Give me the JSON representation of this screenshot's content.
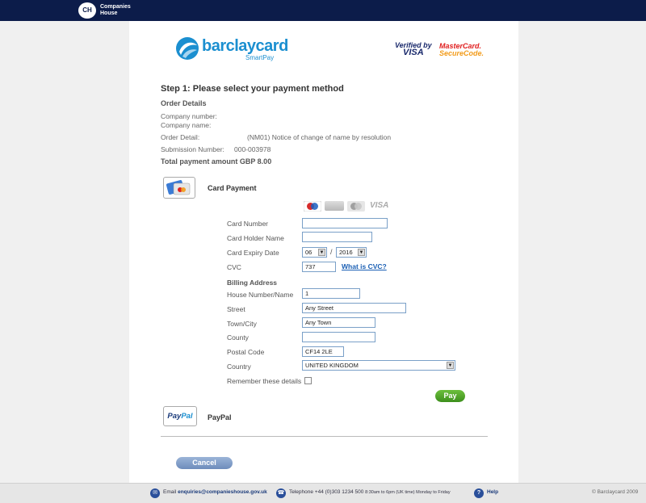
{
  "header": {
    "logo_initials": "CH",
    "logo_text": "Companies House"
  },
  "brand": {
    "name": "barclaycard",
    "product": "SmartPay",
    "verified_by": "Verified by",
    "visa": "VISA",
    "mastercard": "MasterCard.",
    "securecode": "SecureCode."
  },
  "step_title": "Step 1: Please select your payment method",
  "order": {
    "heading": "Order Details",
    "company_number_label": "Company number:",
    "company_name_label": "Company name:",
    "order_detail_label": "Order Detail:",
    "order_detail_value": "(NM01) Notice of change of name by resolution",
    "submission_label": "Submission Number:",
    "submission_value": "000-003978",
    "total": "Total payment amount GBP 8.00"
  },
  "card_payment": {
    "label": "Card Payment",
    "accepted_logo_visa": "VISA",
    "fields": {
      "card_number_label": "Card Number",
      "card_number_value": "",
      "card_holder_label": "Card Holder Name",
      "card_holder_value": "",
      "expiry_label": "Card Expiry Date",
      "expiry_month": "06",
      "expiry_sep": "/",
      "expiry_year": "2016",
      "cvc_label": "CVC",
      "cvc_value": "737",
      "what_is_cvc": "What is CVC?"
    },
    "billing": {
      "heading": "Billing Address",
      "house_label": "House Number/Name",
      "house_value": "1",
      "street_label": "Street",
      "street_value": "Any Street",
      "town_label": "Town/City",
      "town_value": "Any Town",
      "county_label": "County",
      "county_value": "",
      "postal_label": "Postal Code",
      "postal_value": "CF14 2LE",
      "country_label": "Country",
      "country_value": "UNITED KINGDOM",
      "remember_label": "Remember these details"
    },
    "pay_button": "Pay"
  },
  "paypal": {
    "logo_part1": "Pay",
    "logo_part2": "Pal",
    "label": "PayPal"
  },
  "cancel_button": "Cancel",
  "footer": {
    "email_prefix": "Email",
    "email": "enquiries@companieshouse.gov.uk",
    "telephone": "Telephone +44 (0)303 1234 500",
    "hours": "8:30am to 6pm (UK time) Monday to Friday",
    "help": "Help",
    "copyright": "© Barclaycard 2009"
  }
}
